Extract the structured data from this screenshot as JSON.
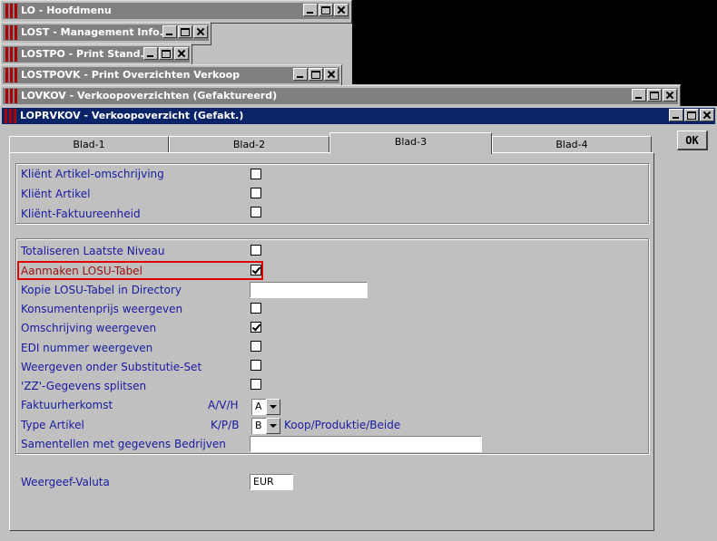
{
  "windows": [
    {
      "title": "LO - Hoofdmenu"
    },
    {
      "title": "LOST - Management Info..."
    },
    {
      "title": "LOSTPO - Print Stand..."
    },
    {
      "title": "LOSTPOVK - Print Overzichten Verkoop"
    },
    {
      "title": "LOVKOV - Verkoopoverzichten (Gefaktureerd)"
    },
    {
      "title": "LOPRVKOV - Verkoopoverzicht (Gefakt.)"
    }
  ],
  "ok_label": "OK",
  "tabs": [
    {
      "label": "Blad-1",
      "active": false
    },
    {
      "label": "Blad-2",
      "active": false
    },
    {
      "label": "Blad-3",
      "active": true
    },
    {
      "label": "Blad-4",
      "active": false
    }
  ],
  "group1": [
    {
      "label": "Kliënt Artikel-omschrijving",
      "checked": false
    },
    {
      "label": "Kliënt Artikel",
      "checked": false
    },
    {
      "label": "Kliënt-Faktuureenheid",
      "checked": false
    }
  ],
  "group2": {
    "totaliseren": {
      "label": "Totaliseren Laatste Niveau",
      "checked": false
    },
    "aanmaken": {
      "label": "Aanmaken LOSU-Tabel",
      "checked": true
    },
    "kopie": {
      "label": "Kopie LOSU-Tabel in Directory",
      "value": ""
    },
    "konsumentenprijs": {
      "label": "Konsumentenprijs weergeven",
      "checked": false
    },
    "omschrijving": {
      "label": "Omschrijving weergeven",
      "checked": true
    },
    "edi": {
      "label": "EDI nummer weergeven",
      "checked": false
    },
    "substitutie": {
      "label": "Weergeven onder Substitutie-Set",
      "checked": false
    },
    "zz": {
      "label": "'ZZ'-Gegevens splitsen",
      "checked": false
    },
    "faktuurherkomst": {
      "label": "Faktuurherkomst",
      "hint": "A/V/H",
      "value": "A"
    },
    "type_artikel": {
      "label": "Type Artikel",
      "hint": "K/P/B",
      "value": "B",
      "desc": "Koop/Produktie/Beide"
    },
    "samentellen": {
      "label": "Samentellen met gegevens Bedrijven",
      "value": ""
    }
  },
  "valuta": {
    "label": "Weergeef-Valuta",
    "value": "EUR"
  }
}
